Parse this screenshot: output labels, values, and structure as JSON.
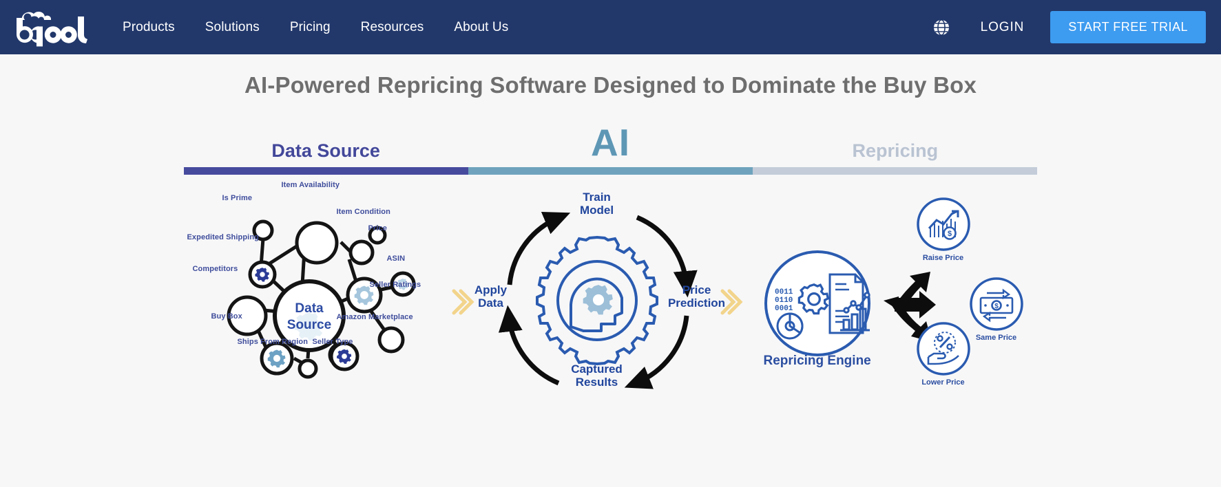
{
  "nav": {
    "logo_text": "bqool",
    "logo_icon": "bqool-cloud-logo",
    "links": [
      {
        "label": "Products"
      },
      {
        "label": "Solutions"
      },
      {
        "label": "Pricing"
      },
      {
        "label": "Resources"
      },
      {
        "label": "About Us"
      }
    ],
    "globe_icon": "globe-icon",
    "login_label": "LOGIN",
    "cta_label": "START FREE TRIAL",
    "bg_color": "#22386b",
    "cta_color": "#3d9bf0"
  },
  "hero": {
    "headline": "AI-Powered Repricing Software Designed to Dominate the Buy Box",
    "headline_color": "#6e6e6e"
  },
  "stages": [
    {
      "label": "Data Source",
      "bar_color": "#474b9e",
      "text_color": "#43489a"
    },
    {
      "label": "AI",
      "bar_color": "#6fa3bd",
      "text_color": "#5e97b5"
    },
    {
      "label": "Repricing",
      "bar_color": "#c3ccd8",
      "text_color": "#b9c3d2"
    }
  ],
  "data_source": {
    "center_label": "Data\nSource",
    "nodes": [
      {
        "label": "Is Prime"
      },
      {
        "label": "Item Availability"
      },
      {
        "label": "Item Condition"
      },
      {
        "label": "Price"
      },
      {
        "label": "ASIN"
      },
      {
        "label": "Seller Ratings"
      },
      {
        "label": "Expedited Shipping"
      },
      {
        "label": "Competitors"
      },
      {
        "label": "Buy Box"
      },
      {
        "label": "Ships From Region"
      },
      {
        "label": "Seller Type"
      },
      {
        "label": "Amazon Marketplace"
      }
    ]
  },
  "ai_cycle": {
    "center_icon": "gear-brain-icon",
    "steps": [
      {
        "label": "Train\nModel"
      },
      {
        "label": "Price\nPrediction"
      },
      {
        "label": "Captured\nResults"
      },
      {
        "label": "Apply\nData"
      }
    ]
  },
  "repricing": {
    "engine_label": "Repricing Engine",
    "engine_icon": "data-analytics-icon",
    "outcomes": [
      {
        "label": "Raise Price",
        "icon": "chart-up-dollar-icon"
      },
      {
        "label": "Same Price",
        "icon": "banknote-dollar-icon"
      },
      {
        "label": "Lower Price",
        "icon": "hand-percent-icon"
      }
    ],
    "arrow_icon": "three-way-arrow-icon"
  },
  "chevrons": {
    "color": "#f2d48b",
    "icon": "double-chevron-right-icon"
  }
}
